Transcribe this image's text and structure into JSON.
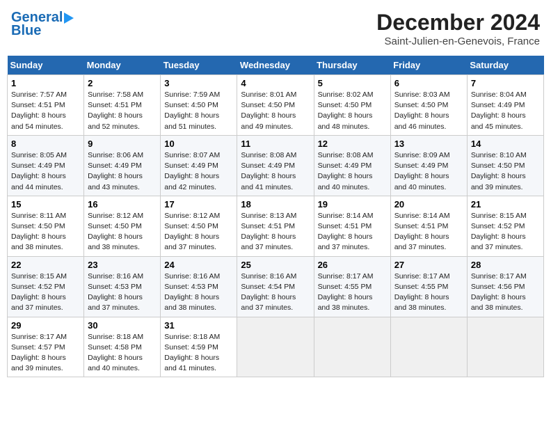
{
  "header": {
    "logo_line1": "General",
    "logo_line2": "Blue",
    "month_title": "December 2024",
    "location": "Saint-Julien-en-Genevois, France"
  },
  "weekdays": [
    "Sunday",
    "Monday",
    "Tuesday",
    "Wednesday",
    "Thursday",
    "Friday",
    "Saturday"
  ],
  "weeks": [
    [
      {
        "day": "1",
        "info": "Sunrise: 7:57 AM\nSunset: 4:51 PM\nDaylight: 8 hours and 54 minutes."
      },
      {
        "day": "2",
        "info": "Sunrise: 7:58 AM\nSunset: 4:51 PM\nDaylight: 8 hours and 52 minutes."
      },
      {
        "day": "3",
        "info": "Sunrise: 7:59 AM\nSunset: 4:50 PM\nDaylight: 8 hours and 51 minutes."
      },
      {
        "day": "4",
        "info": "Sunrise: 8:01 AM\nSunset: 4:50 PM\nDaylight: 8 hours and 49 minutes."
      },
      {
        "day": "5",
        "info": "Sunrise: 8:02 AM\nSunset: 4:50 PM\nDaylight: 8 hours and 48 minutes."
      },
      {
        "day": "6",
        "info": "Sunrise: 8:03 AM\nSunset: 4:50 PM\nDaylight: 8 hours and 46 minutes."
      },
      {
        "day": "7",
        "info": "Sunrise: 8:04 AM\nSunset: 4:49 PM\nDaylight: 8 hours and 45 minutes."
      }
    ],
    [
      {
        "day": "8",
        "info": "Sunrise: 8:05 AM\nSunset: 4:49 PM\nDaylight: 8 hours and 44 minutes."
      },
      {
        "day": "9",
        "info": "Sunrise: 8:06 AM\nSunset: 4:49 PM\nDaylight: 8 hours and 43 minutes."
      },
      {
        "day": "10",
        "info": "Sunrise: 8:07 AM\nSunset: 4:49 PM\nDaylight: 8 hours and 42 minutes."
      },
      {
        "day": "11",
        "info": "Sunrise: 8:08 AM\nSunset: 4:49 PM\nDaylight: 8 hours and 41 minutes."
      },
      {
        "day": "12",
        "info": "Sunrise: 8:08 AM\nSunset: 4:49 PM\nDaylight: 8 hours and 40 minutes."
      },
      {
        "day": "13",
        "info": "Sunrise: 8:09 AM\nSunset: 4:49 PM\nDaylight: 8 hours and 40 minutes."
      },
      {
        "day": "14",
        "info": "Sunrise: 8:10 AM\nSunset: 4:50 PM\nDaylight: 8 hours and 39 minutes."
      }
    ],
    [
      {
        "day": "15",
        "info": "Sunrise: 8:11 AM\nSunset: 4:50 PM\nDaylight: 8 hours and 38 minutes."
      },
      {
        "day": "16",
        "info": "Sunrise: 8:12 AM\nSunset: 4:50 PM\nDaylight: 8 hours and 38 minutes."
      },
      {
        "day": "17",
        "info": "Sunrise: 8:12 AM\nSunset: 4:50 PM\nDaylight: 8 hours and 37 minutes."
      },
      {
        "day": "18",
        "info": "Sunrise: 8:13 AM\nSunset: 4:51 PM\nDaylight: 8 hours and 37 minutes."
      },
      {
        "day": "19",
        "info": "Sunrise: 8:14 AM\nSunset: 4:51 PM\nDaylight: 8 hours and 37 minutes."
      },
      {
        "day": "20",
        "info": "Sunrise: 8:14 AM\nSunset: 4:51 PM\nDaylight: 8 hours and 37 minutes."
      },
      {
        "day": "21",
        "info": "Sunrise: 8:15 AM\nSunset: 4:52 PM\nDaylight: 8 hours and 37 minutes."
      }
    ],
    [
      {
        "day": "22",
        "info": "Sunrise: 8:15 AM\nSunset: 4:52 PM\nDaylight: 8 hours and 37 minutes."
      },
      {
        "day": "23",
        "info": "Sunrise: 8:16 AM\nSunset: 4:53 PM\nDaylight: 8 hours and 37 minutes."
      },
      {
        "day": "24",
        "info": "Sunrise: 8:16 AM\nSunset: 4:53 PM\nDaylight: 8 hours and 38 minutes."
      },
      {
        "day": "25",
        "info": "Sunrise: 8:16 AM\nSunset: 4:54 PM\nDaylight: 8 hours and 37 minutes."
      },
      {
        "day": "26",
        "info": "Sunrise: 8:17 AM\nSunset: 4:55 PM\nDaylight: 8 hours and 38 minutes."
      },
      {
        "day": "27",
        "info": "Sunrise: 8:17 AM\nSunset: 4:55 PM\nDaylight: 8 hours and 38 minutes."
      },
      {
        "day": "28",
        "info": "Sunrise: 8:17 AM\nSunset: 4:56 PM\nDaylight: 8 hours and 38 minutes."
      }
    ],
    [
      {
        "day": "29",
        "info": "Sunrise: 8:17 AM\nSunset: 4:57 PM\nDaylight: 8 hours and 39 minutes."
      },
      {
        "day": "30",
        "info": "Sunrise: 8:18 AM\nSunset: 4:58 PM\nDaylight: 8 hours and 40 minutes."
      },
      {
        "day": "31",
        "info": "Sunrise: 8:18 AM\nSunset: 4:59 PM\nDaylight: 8 hours and 41 minutes."
      },
      {
        "day": "",
        "info": ""
      },
      {
        "day": "",
        "info": ""
      },
      {
        "day": "",
        "info": ""
      },
      {
        "day": "",
        "info": ""
      }
    ]
  ]
}
